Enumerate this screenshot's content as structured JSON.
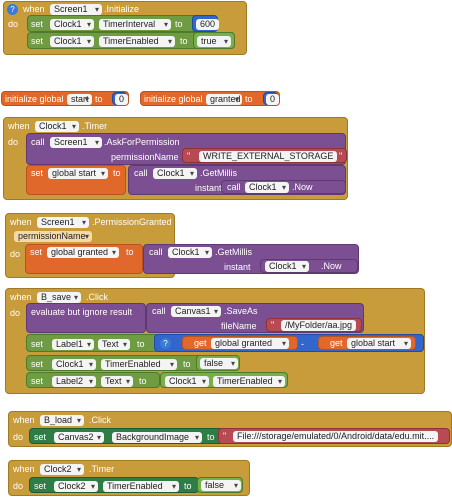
{
  "k": {
    "when": "when",
    "do": "do",
    "set": "set",
    "to": "to",
    "call": "call",
    "initialize_global": "initialize global",
    "evaluate_ignore": "evaluate but ignore result",
    "get": "get",
    "minus": "-",
    "instant": "instant",
    "question": "?"
  },
  "b1": {
    "component": "Screen1",
    "event": ".Initialize",
    "set1_comp": "Clock1",
    "set1_prop": "TimerInterval",
    "set1_val": "600",
    "set2_comp": "Clock1",
    "set2_prop": "TimerEnabled",
    "set2_val": "true"
  },
  "globals": {
    "g1_name": "start",
    "g1_val": "0",
    "g2_name": "granted",
    "g2_val": "0"
  },
  "b2": {
    "component": "Clock1",
    "event": ".Timer",
    "call_comp": "Screen1",
    "method": ".AskForPermission",
    "param": "permissionName",
    "param_val": "WRITE_EXTERNAL_STORAGE",
    "set_var": "global start",
    "call2_comp": "Clock1",
    "method2": ".GetMillis",
    "instant_comp": "Clock1",
    "instant_prop": ".Now"
  },
  "b3": {
    "component": "Screen1",
    "event": ".PermissionGranted",
    "param": "permissionName",
    "set_var": "global granted",
    "call_comp": "Clock1",
    "method": ".GetMillis",
    "instant_comp": "Clock1",
    "instant_prop": ".Now"
  },
  "b4": {
    "component": "B_save",
    "event": ".Click",
    "call_comp": "Canvas1",
    "method": ".SaveAs",
    "param": "fileName",
    "param_val": "/MyFolder/aa.jpg",
    "s1_comp": "Label1",
    "s1_prop": "Text",
    "get1": "global granted",
    "get2": "global start",
    "s2_comp": "Clock1",
    "s2_prop": "TimerEnabled",
    "s2_val": "false",
    "s3_comp": "Label2",
    "s3_prop": "Text",
    "s3_val_comp": "Clock1",
    "s3_val_prop": "TimerEnabled"
  },
  "b5": {
    "component": "B_load",
    "event": ".Click",
    "set_comp": "Canvas2",
    "set_prop": "BackgroundImage",
    "val": "File:///storage/emulated/0/Android/data/edu.mit...."
  },
  "b6": {
    "component": "Clock2",
    "event": ".Timer",
    "set_comp": "Clock2",
    "set_prop": "TimerEnabled",
    "set_val": "false"
  }
}
